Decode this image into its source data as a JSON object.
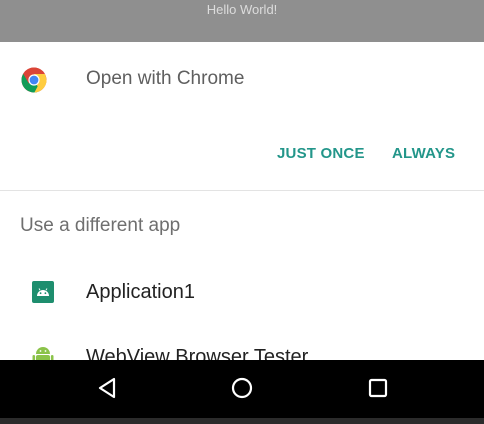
{
  "background_app": {
    "text": "Hello World!"
  },
  "chooser": {
    "default_app": {
      "icon": "chrome-icon",
      "label": "Open with Chrome"
    },
    "actions": {
      "just_once": "JUST ONCE",
      "always": "ALWAYS"
    },
    "section_label": "Use a different app",
    "apps": [
      {
        "icon": "android-app-icon",
        "label": "Application1"
      },
      {
        "icon": "android-robot-icon",
        "label": "WebView Browser Tester"
      }
    ]
  },
  "navbar": {
    "buttons": [
      "back-icon",
      "home-icon",
      "recents-icon"
    ]
  },
  "colors": {
    "accent": "#23968a",
    "sheet_background": "#ffffff",
    "navbar_background": "#000000",
    "scrim": "#8f8f8f"
  }
}
